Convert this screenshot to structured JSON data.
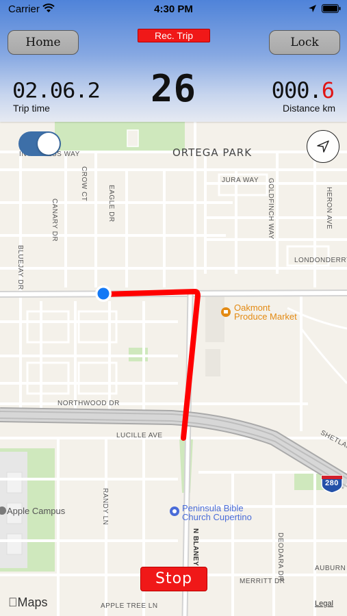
{
  "status_bar": {
    "carrier": "Carrier",
    "time": "4:30 PM"
  },
  "header": {
    "home_label": "Home",
    "lock_label": "Lock",
    "rec_badge": "Rec. Trip",
    "trip_time_value": "02.06.2",
    "trip_time_label": "Trip time",
    "speed_value": "26",
    "distance_int": "000.",
    "distance_dec": "6",
    "distance_label": "Distance km"
  },
  "map": {
    "park_name": "ORTEGA PARK",
    "streets": {
      "inverness": "INVERNESS WAY",
      "crow": "CROW CT",
      "eagle": "EAGLE DR",
      "canary": "CANARY DR",
      "jura": "JURA WAY",
      "goldfinch": "GOLDFINCH WAY",
      "heron": "HERON AVE",
      "bluejay": "BLUEJAY DR",
      "londonderry": "LONDONDERRY",
      "northwood": "NORTHWOOD DR",
      "lucille": "LUCILLE AVE",
      "randy": "RANDY LN",
      "blaney": "N BLANEY",
      "deodara": "DEODARA DR",
      "auburn": "AUBURN",
      "merritt": "MERRITT DR",
      "apple_tree": "APPLE TREE LN",
      "shetland": "SHETLAN"
    },
    "pois": {
      "oakmont_line1": "Oakmont",
      "oakmont_line2": "Produce Market",
      "church_line1": "Peninsula Bible",
      "church_line2": "Church Cupertino",
      "apple_campus": "Apple Campus"
    },
    "highway_shield": "280",
    "attribution": "Maps",
    "legal": "Legal",
    "colors": {
      "route": "#ff0000",
      "user_dot": "#1479f5",
      "poi_orange": "#e38a13",
      "poi_blue": "#4a6cd8",
      "park_green": "#cfe8bd"
    }
  },
  "controls": {
    "toggle_on": true,
    "stop_label": "Stop"
  }
}
